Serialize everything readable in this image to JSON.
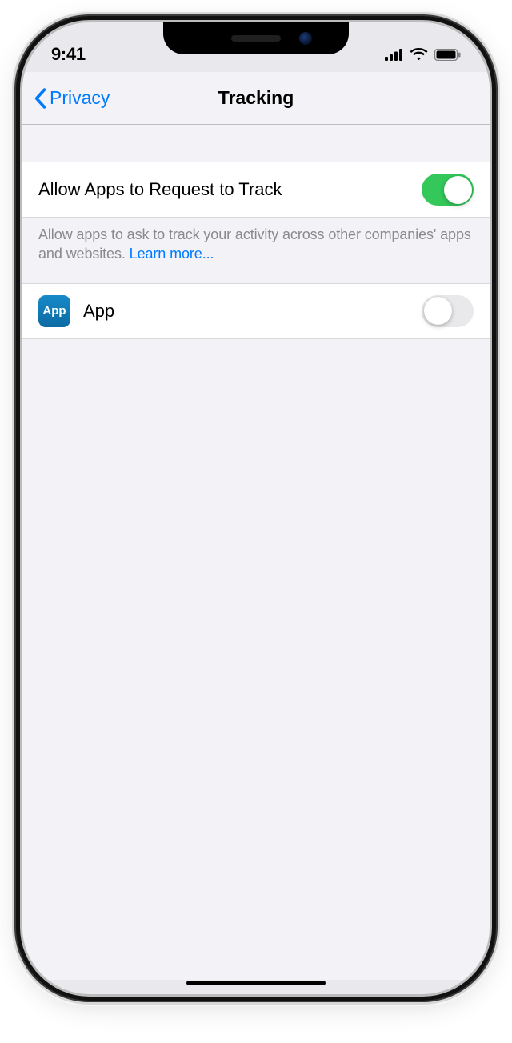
{
  "status": {
    "time": "9:41"
  },
  "nav": {
    "back_label": "Privacy",
    "title": "Tracking"
  },
  "master": {
    "label": "Allow Apps to Request to Track",
    "enabled": true
  },
  "footer": {
    "text": "Allow apps to ask to track your activity across other companies' apps and websites. ",
    "link": "Learn more..."
  },
  "apps": [
    {
      "name": "App",
      "icon_text": "App",
      "enabled": false
    }
  ]
}
